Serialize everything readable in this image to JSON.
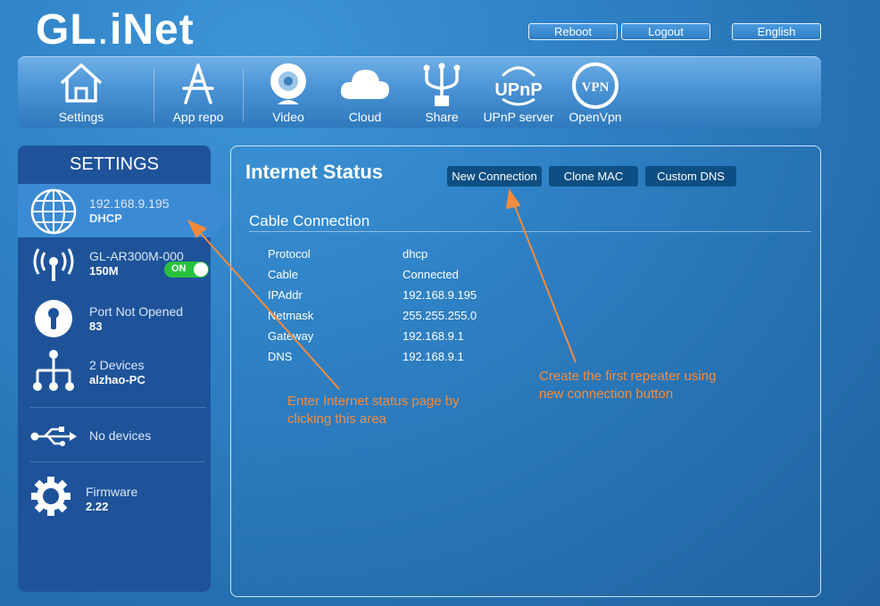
{
  "brand": {
    "logo_main": "GL",
    "logo_dot": ".",
    "logo_tail": "iNet"
  },
  "top_buttons": {
    "reboot": "Reboot",
    "logout": "Logout",
    "language": "English"
  },
  "nav": [
    {
      "label": "Settings",
      "icon": "home-icon"
    },
    {
      "label": "App repo",
      "icon": "app-store-icon"
    },
    {
      "label": "Video",
      "icon": "webcam-icon"
    },
    {
      "label": "Cloud",
      "icon": "cloud-icon"
    },
    {
      "label": "Share",
      "icon": "usb-share-icon"
    },
    {
      "label": "UPnP server",
      "icon": "upnp-icon",
      "icon_text": "UPnP"
    },
    {
      "label": "OpenVpn",
      "icon": "vpn-icon",
      "icon_text": "VPN"
    }
  ],
  "sidebar": {
    "title": "SETTINGS",
    "items": [
      {
        "line1": "192.168.9.195",
        "line2": "DHCP",
        "icon": "globe-icon",
        "active": true
      },
      {
        "line1": "GL-AR300M-000",
        "line2": "150M",
        "icon": "wifi-icon",
        "toggle": "ON"
      },
      {
        "line1": "Port Not Opened",
        "line2": "83",
        "icon": "keyhole-icon"
      },
      {
        "line1": "2 Devices",
        "line2": "alzhao-PC",
        "icon": "network-tree-icon"
      },
      {
        "line1": "No devices",
        "line2": "",
        "icon": "usb-icon"
      },
      {
        "line1": "Firmware",
        "line2": "2.22",
        "icon": "gear-icon"
      }
    ]
  },
  "main": {
    "title": "Internet Status",
    "buttons": {
      "new_connection": "New Connection",
      "clone_mac": "Clone MAC",
      "custom_dns": "Custom DNS"
    },
    "section_title": "Cable Connection",
    "rows": [
      {
        "key": "Protocol",
        "value": "dhcp"
      },
      {
        "key": "Cable",
        "value": "Connected"
      },
      {
        "key": "IPAddr",
        "value": "192.168.9.195"
      },
      {
        "key": "Netmask",
        "value": "255.255.255.0"
      },
      {
        "key": "Gateway",
        "value": "192.168.9.1"
      },
      {
        "key": "DNS",
        "value": "192.168.9.1"
      }
    ]
  },
  "annotations": {
    "left": [
      "Enter Internet status page by",
      "clicking this area"
    ],
    "right": [
      "Create the first repeater using",
      "new connection button"
    ],
    "color": "#f58b3c"
  }
}
